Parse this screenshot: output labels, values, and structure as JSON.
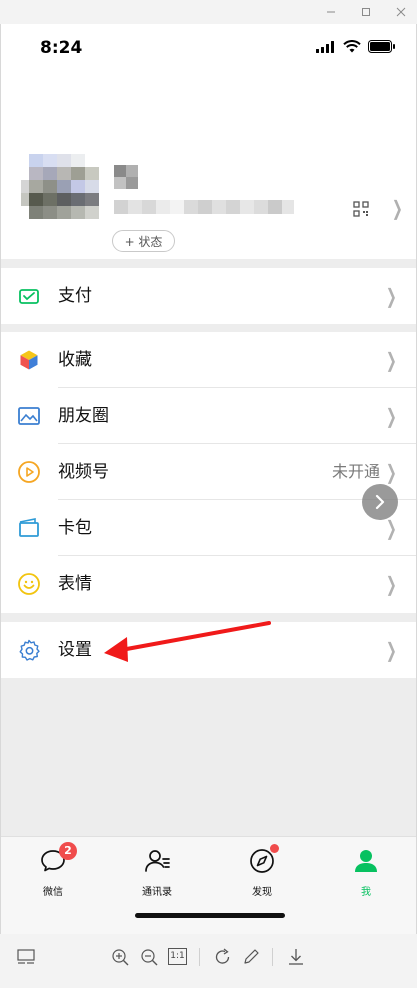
{
  "window": {
    "icons": [
      "minimize-icon",
      "maximize-icon",
      "close-icon"
    ]
  },
  "status_bar": {
    "time": "8:24",
    "icons": [
      "signal-icon",
      "wifi-icon",
      "battery-icon"
    ]
  },
  "profile": {
    "status_button": "+ 状态",
    "icons": [
      "qr-code-icon",
      "chevron-right-icon"
    ]
  },
  "menu": {
    "pay": {
      "label": "支付",
      "icon": "wallet-icon",
      "color": "#07c160"
    },
    "favorites": {
      "label": "收藏",
      "icon": "cube-icon"
    },
    "moments": {
      "label": "朋友圈",
      "icon": "image-icon",
      "color": "#3b7fd1"
    },
    "channels": {
      "label": "视频号",
      "icon": "play-circle-icon",
      "color": "#f5a623",
      "value": "未开通"
    },
    "cards": {
      "label": "卡包",
      "icon": "card-icon",
      "color": "#2f9bd6"
    },
    "stickers": {
      "label": "表情",
      "icon": "smile-icon",
      "color": "#f2c40f"
    },
    "settings": {
      "label": "设置",
      "icon": "gear-icon",
      "color": "#3b7fd1"
    }
  },
  "annotation": {
    "color": "#f01a1a"
  },
  "tabbar": {
    "items": [
      {
        "label": "微信",
        "icon": "chat-icon",
        "badge": "2"
      },
      {
        "label": "通讯录",
        "icon": "contacts-icon"
      },
      {
        "label": "发现",
        "icon": "compass-icon"
      },
      {
        "label": "我",
        "icon": "person-icon",
        "active": true
      }
    ],
    "active_color": "#07c160"
  },
  "viewer_toolbar": {
    "actual_size_label": "1:1",
    "icons": [
      "layout-icon",
      "zoom-in-icon",
      "zoom-out-icon",
      "actual-size-icon",
      "rotate-icon",
      "pen-icon",
      "download-icon"
    ]
  }
}
